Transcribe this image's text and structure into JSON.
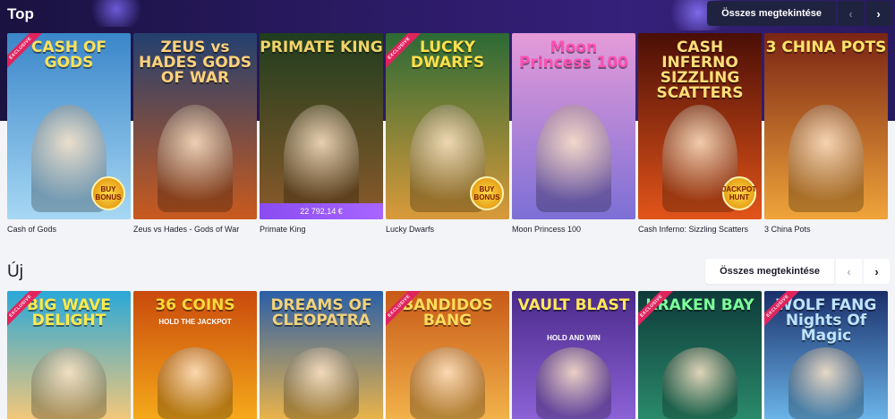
{
  "sections": {
    "top": {
      "title": "Top",
      "see_all_label": "Összes megtekintése",
      "games": [
        {
          "name": "Cash of Gods",
          "art_title": "CASH OF GODS",
          "exclusive": true,
          "badge": "BUY BONUS",
          "bg": "#3a86c9",
          "bg2": "#a7d8f4",
          "title_color": "#ffe15a"
        },
        {
          "name": "Zeus vs Hades - Gods of War",
          "art_title": "ZEUS vs HADES GODS OF WAR",
          "exclusive": false,
          "badge": "",
          "bg": "#23406f",
          "bg2": "#c95a1e",
          "title_color": "#ffd27a"
        },
        {
          "name": "Primate King",
          "art_title": "PRIMATE KING",
          "exclusive": false,
          "badge": "",
          "jackpot": "22 792,14 €",
          "bg": "#1f3d1f",
          "bg2": "#8b5a2a",
          "title_color": "#f0d36a"
        },
        {
          "name": "Lucky Dwarfs",
          "art_title": "LUCKY DWARFS",
          "exclusive": true,
          "badge": "BUY BONUS",
          "bg": "#2c6a35",
          "bg2": "#d99a3a",
          "title_color": "#ffe04a"
        },
        {
          "name": "Moon Princess 100",
          "art_title": "Moon Princess 100",
          "exclusive": false,
          "badge": "",
          "bg": "#e59bd8",
          "bg2": "#7c6fd6",
          "title_color": "#ff4fb4"
        },
        {
          "name": "Cash Inferno: Sizzling Scatters",
          "art_title": "CASH INFERNO SIZZLING SCATTERS",
          "exclusive": false,
          "badge": "JACKPOT HUNT",
          "bg": "#4a0e06",
          "bg2": "#e2541a",
          "title_color": "#ffdf7a"
        },
        {
          "name": "3 China Pots",
          "art_title": "3 CHINA POTS",
          "exclusive": false,
          "badge": "",
          "bg": "#7a2414",
          "bg2": "#f0a43a",
          "title_color": "#ffe36a"
        }
      ]
    },
    "new": {
      "title": "Új",
      "see_all_label": "Összes megtekintése",
      "games": [
        {
          "name": "Big Wave Delight",
          "art_title": "BIG WAVE DELIGHT",
          "exclusive": true,
          "bg": "#2aa8d8",
          "bg2": "#f2c77a",
          "title_color": "#ffe94a"
        },
        {
          "name": "36 Coins",
          "art_title": "36 COINS",
          "subtitle": "HOLD THE JACKPOT",
          "exclusive": false,
          "bg": "#c94a0c",
          "bg2": "#f5a91a",
          "title_color": "#ffd83a"
        },
        {
          "name": "Dreams of Cleopatra",
          "art_title": "DREAMS OF CLEOPATRA",
          "exclusive": false,
          "bg": "#2a5fa8",
          "bg2": "#e9b34a",
          "title_color": "#f2d27a"
        },
        {
          "name": "Bandidos Bang",
          "art_title": "BANDIDOS BANG",
          "exclusive": true,
          "bg": "#c85a18",
          "bg2": "#f2b24a",
          "title_color": "#ffdc5a"
        },
        {
          "name": "Vault Blast",
          "art_title": "VAULT BLAST",
          "subtitle": "HOLD AND WIN",
          "exclusive": false,
          "bg": "#4a2a8a",
          "bg2": "#8c62d6",
          "title_color": "#ffe85a"
        },
        {
          "name": "Kraken Bay",
          "art_title": "KRAKEN BAY",
          "exclusive": true,
          "bg": "#0e3a3a",
          "bg2": "#2a8a6a",
          "title_color": "#7dff9a"
        },
        {
          "name": "Wolf Fang Nights of Magic",
          "art_title": "WOLF FANG Nights Of Magic",
          "exclusive": true,
          "bg": "#1a2f6a",
          "bg2": "#6ab4e8",
          "title_color": "#bfe4ff"
        }
      ]
    }
  },
  "icons": {
    "prev": "chevron-left-icon",
    "next": "chevron-right-icon"
  },
  "labels": {
    "exclusive": "EXCLUSIVE"
  }
}
